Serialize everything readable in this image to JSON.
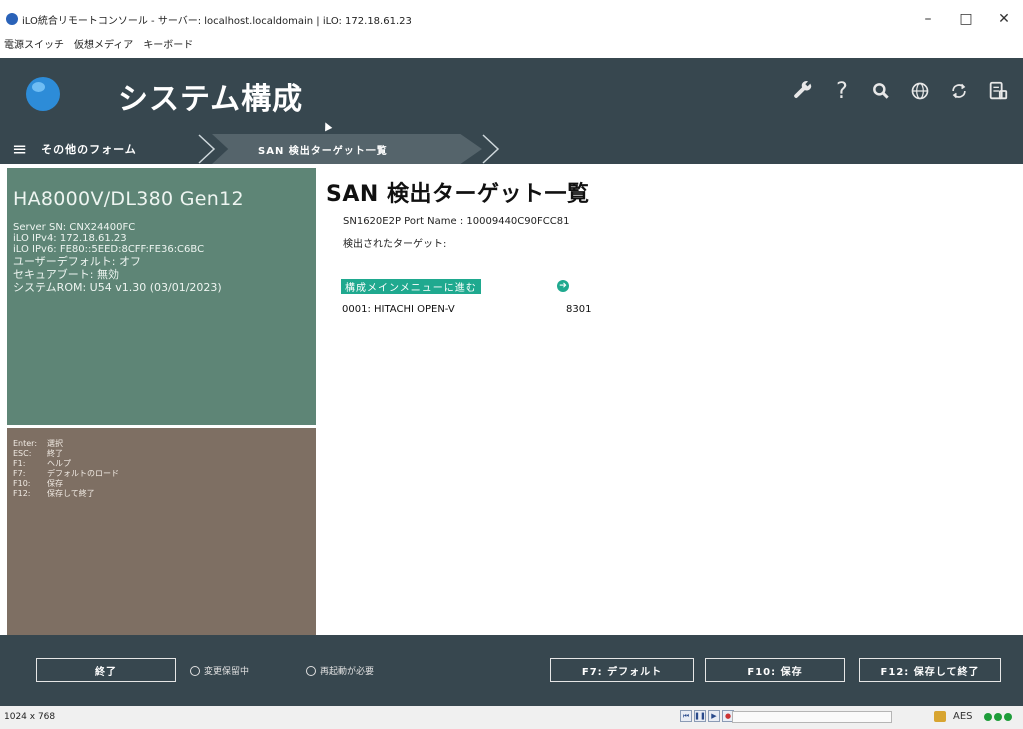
{
  "window": {
    "title": "iLO統合リモートコンソール - サーバー: localhost.localdomain | iLO: 172.18.61.23",
    "controls": [
      "–",
      "□",
      "✕"
    ]
  },
  "menubar": [
    "電源スイッチ",
    "仮想メディア",
    "キーボード"
  ],
  "header": {
    "title": "システム構成",
    "icons": [
      "wrench-icon",
      "help-icon",
      "search-icon",
      "globe-icon",
      "refresh-icon",
      "log-icon"
    ]
  },
  "breadcrumb": {
    "menu_label": "その他のフォーム",
    "current": "SAN 検出ターゲット一覧"
  },
  "system": {
    "model": "HA8000V/DL380 Gen12",
    "lines": [
      "Server SN: CNX24400FC",
      "iLO IPv4: 172.18.61.23",
      "iLO IPv6: FE80::5EED:8CFF:FE36:C6BC",
      "ユーザーデフォルト: オフ",
      "セキュアブート: 無効",
      "システムROM: U54 v1.30 (03/01/2023)"
    ]
  },
  "keys": [
    {
      "key": "Enter:",
      "desc": "選択"
    },
    {
      "key": "ESC:",
      "desc": "終了"
    },
    {
      "key": "F1:",
      "desc": "ヘルプ"
    },
    {
      "key": "F7:",
      "desc": "デフォルトのロード"
    },
    {
      "key": "F10:",
      "desc": "保存"
    },
    {
      "key": "F12:",
      "desc": "保存して終了"
    }
  ],
  "main": {
    "title": "SAN 検出ターゲット一覧",
    "port_info": "SN1620E2P Port Name : 10009440C90FCC81",
    "detected_label": "検出されたターゲット:",
    "menu_link": "構成メインメニューに進む",
    "target": {
      "id": "0001: HITACHI OPEN-V",
      "value": "8301"
    }
  },
  "footer": {
    "exit": "終了",
    "radio_pending": "変更保留中",
    "radio_reboot": "再起動が必要",
    "f7": "F7: デフォルト",
    "f10": "F10: 保存",
    "f12": "F12: 保存して終了"
  },
  "status": {
    "resolution": "1024 x 768",
    "encryption": "AES"
  },
  "colors": {
    "header_bg": "#37474f",
    "sysinfo_bg": "#5e8576",
    "keyhelp_bg": "#7e6f63",
    "accent": "#1fa98f"
  }
}
